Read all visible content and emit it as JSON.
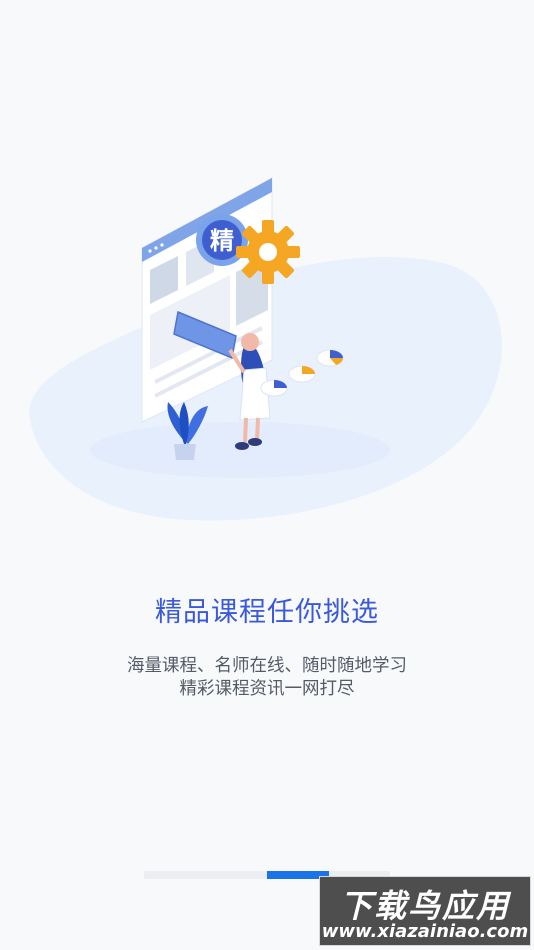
{
  "colors": {
    "accent": "#3a5ad9",
    "pager_active": "#1a73e8",
    "pager_track": "#eceef2",
    "illustration_blob": "#e8f0fd",
    "gear": "#f5a623"
  },
  "illustration": {
    "badge_char": "精",
    "icons": [
      "document-window-icon",
      "gear-icon",
      "plant-icon",
      "pie-chart-icon"
    ]
  },
  "onboarding": {
    "title": "精品课程任你挑选",
    "line1": "海量课程、名师在线、随时随地学习",
    "line2": "精彩课程资讯一网打尽"
  },
  "pager": {
    "total": 4,
    "active_index": 2
  },
  "watermark": {
    "title": "下载鸟应用",
    "url": "www.xiazainiao.com"
  }
}
